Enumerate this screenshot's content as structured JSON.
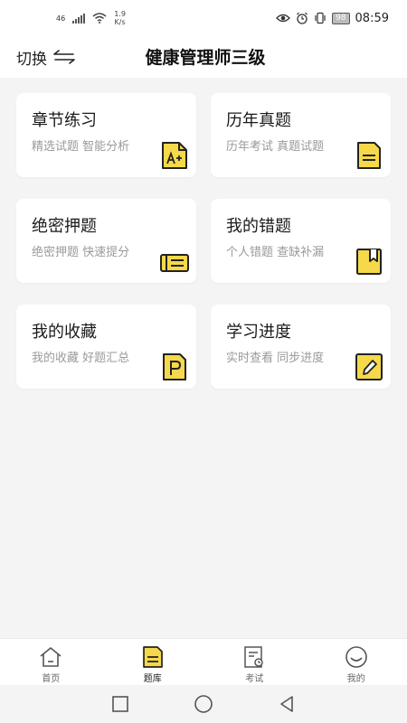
{
  "status_bar": {
    "signal_label": "46",
    "net_speed_value": "1.9",
    "net_speed_unit": "K/s",
    "battery": "98",
    "time": "08:59"
  },
  "header": {
    "switch_label": "切换",
    "title": "健康管理师三级"
  },
  "cards": [
    {
      "title": "章节练习",
      "subtitle": "精选试题 智能分析",
      "icon": "a-plus-document-icon"
    },
    {
      "title": "历年真题",
      "subtitle": "历年考试 真题试题",
      "icon": "document-lines-icon"
    },
    {
      "title": "绝密押题",
      "subtitle": "绝密押题 快速提分",
      "icon": "ticket-icon"
    },
    {
      "title": "我的错题",
      "subtitle": "个人错题 查缺补漏",
      "icon": "bookmark-book-icon"
    },
    {
      "title": "我的收藏",
      "subtitle": "我的收藏 好题汇总",
      "icon": "p-document-icon"
    },
    {
      "title": "学习进度",
      "subtitle": "实时查看 同步进度",
      "icon": "pencil-icon"
    }
  ],
  "bottom_nav": [
    {
      "label": "首页",
      "icon": "home-icon",
      "active": false
    },
    {
      "label": "题库",
      "icon": "question-bank-icon",
      "active": true
    },
    {
      "label": "考试",
      "icon": "exam-icon",
      "active": false
    },
    {
      "label": "我的",
      "icon": "profile-icon",
      "active": false
    }
  ],
  "colors": {
    "accent": "#f5d94a",
    "icon_stroke": "#222222",
    "page_bg": "#f4f4f4"
  }
}
